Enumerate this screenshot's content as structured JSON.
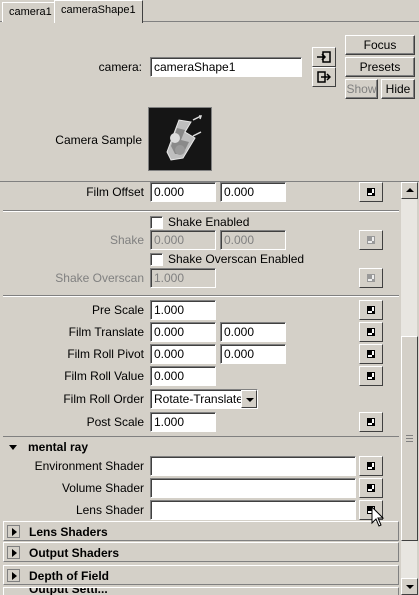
{
  "tabs": [
    {
      "label": "camera1",
      "active": false
    },
    {
      "label": "cameraShape1",
      "active": true
    }
  ],
  "header": {
    "camera_label": "camera:",
    "camera_value": "cameraShape1",
    "focus_label": "Focus",
    "presets_label": "Presets",
    "show_label": "Show",
    "hide_label": "Hide",
    "sample_label": "Camera Sample"
  },
  "film_offset": {
    "label": "Film Offset",
    "x": "0.000",
    "y": "0.000"
  },
  "shake": {
    "shake_enabled_label": "Shake Enabled",
    "shake_label": "Shake",
    "shake_x": "0.000",
    "shake_y": "0.000",
    "overscan_enabled_label": "Shake Overscan Enabled",
    "overscan_label": "Shake Overscan",
    "overscan_value": "1.000"
  },
  "film": {
    "pre_scale_label": "Pre Scale",
    "pre_scale": "1.000",
    "translate_label": "Film Translate",
    "translate_x": "0.000",
    "translate_y": "0.000",
    "roll_pivot_label": "Film Roll Pivot",
    "roll_pivot_x": "0.000",
    "roll_pivot_y": "0.000",
    "roll_value_label": "Film Roll Value",
    "roll_value": "0.000",
    "roll_order_label": "Film Roll Order",
    "roll_order": "Rotate-Translate",
    "post_scale_label": "Post Scale",
    "post_scale": "1.000"
  },
  "mental_ray": {
    "title": "mental ray",
    "env_label": "Environment Shader",
    "env_value": "",
    "volume_label": "Volume Shader",
    "volume_value": "",
    "lens_label": "Lens Shader",
    "lens_value": ""
  },
  "sections": {
    "lens_shaders": "Lens Shaders",
    "output_shaders": "Output Shaders",
    "depth_of_field": "Depth of Field",
    "output_settings": "Output Setti..."
  }
}
